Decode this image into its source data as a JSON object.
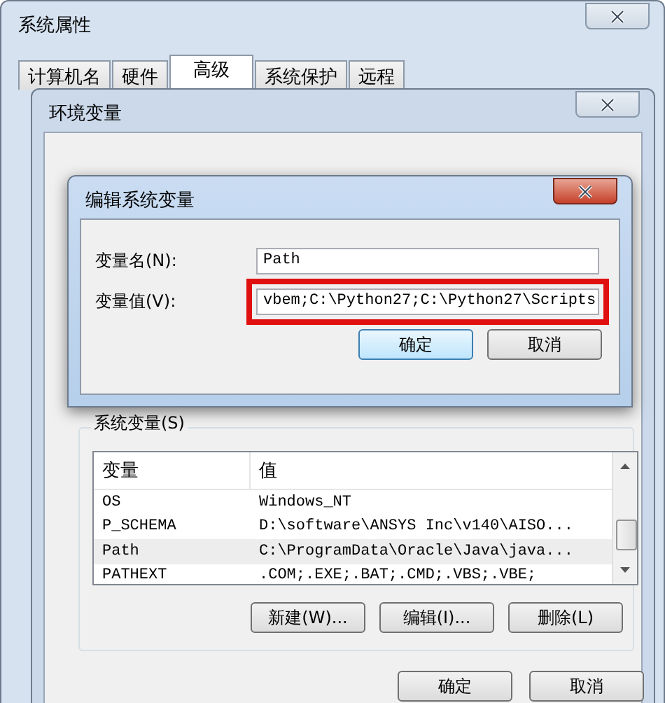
{
  "system_properties": {
    "title": "系统属性",
    "tabs": [
      {
        "label": "计算机名",
        "selected": false
      },
      {
        "label": "硬件",
        "selected": false
      },
      {
        "label": "高级",
        "selected": true
      },
      {
        "label": "系统保护",
        "selected": false
      },
      {
        "label": "远程",
        "selected": false
      }
    ]
  },
  "environment_variables": {
    "title": "环境变量",
    "system_group_label": "系统变量(S)",
    "columns": [
      "变量",
      "值"
    ],
    "rows": [
      {
        "name": "OS",
        "value": "Windows_NT",
        "selected": false
      },
      {
        "name": "P_SCHEMA",
        "value": "D:\\software\\ANSYS Inc\\v140\\AISO...",
        "selected": false
      },
      {
        "name": "Path",
        "value": "C:\\ProgramData\\Oracle\\Java\\java...",
        "selected": true
      },
      {
        "name": "PATHEXT",
        "value": ".COM;.EXE;.BAT;.CMD;.VBS;.VBE;",
        "selected": false
      }
    ],
    "list_buttons": [
      "新建(W)...",
      "编辑(I)...",
      "删除(L)"
    ],
    "buttons": [
      "确定",
      "取消"
    ]
  },
  "edit_dialog": {
    "title": "编辑系统变量",
    "name_label": "变量名(N):",
    "name_value": "Path",
    "value_label": "变量值(V):",
    "value_value": "vbem;C:\\Python27;C:\\Python27\\Scripts",
    "buttons": [
      {
        "label": "确定",
        "default": true
      },
      {
        "label": "取消",
        "default": false
      }
    ]
  }
}
